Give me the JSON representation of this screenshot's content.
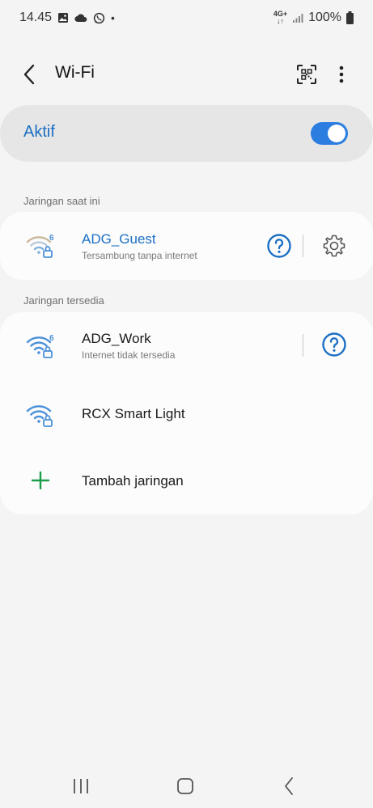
{
  "status_bar": {
    "time": "14.45",
    "network_type": "4G+",
    "battery": "100%",
    "icons": [
      "image-icon",
      "cloud-icon",
      "whatsapp-icon",
      "dot-icon",
      "signal-icon",
      "battery-icon"
    ]
  },
  "header": {
    "title": "Wi-Fi",
    "icons": [
      "back-icon",
      "qr-code-icon",
      "more-options-icon"
    ]
  },
  "wifi_toggle": {
    "label": "Aktif",
    "state": "on",
    "accent": "#2b7de0"
  },
  "current_section": {
    "label": "Jaringan saat ini",
    "network": {
      "name": "ADG_Guest",
      "status": "Tersambung tanpa internet",
      "badge": "6"
    }
  },
  "available_section": {
    "label": "Jaringan tersedia",
    "networks": [
      {
        "name": "ADG_Work",
        "status": "Internet tidak tersedia",
        "badge": "6"
      },
      {
        "name": "RCX Smart Light",
        "status": "",
        "badge": ""
      }
    ],
    "add_network_label": "Tambah jaringan"
  },
  "nav_bar": {
    "icons": [
      "recent-apps-icon",
      "home-icon",
      "back-nav-icon"
    ]
  },
  "colors": {
    "accent_blue": "#1c6fc4",
    "add_green": "#1a9e4a",
    "wifi_icon": "#4a90d9"
  }
}
